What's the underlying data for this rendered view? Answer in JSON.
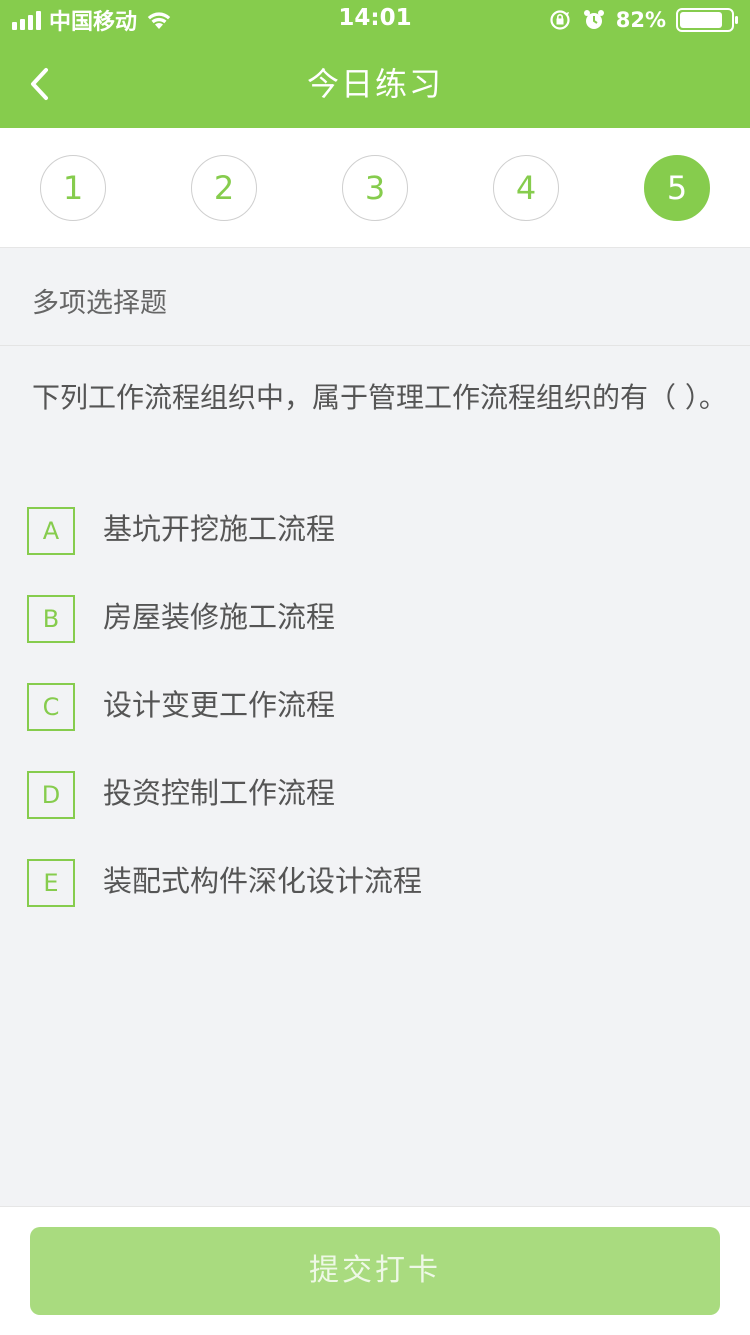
{
  "status_bar": {
    "carrier": "中国移动",
    "time": "14:01",
    "battery": "82%"
  },
  "nav": {
    "title": "今日练习"
  },
  "question_numbers": [
    "1",
    "2",
    "3",
    "4",
    "5"
  ],
  "active_question": "5",
  "question_type": "多项选择题",
  "question_stem": "下列工作流程组织中，属于管理工作流程组织的有（ ）。",
  "options": [
    {
      "letter": "A",
      "text": "基坑开挖施工流程"
    },
    {
      "letter": "B",
      "text": "房屋装修施工流程"
    },
    {
      "letter": "C",
      "text": "设计变更工作流程"
    },
    {
      "letter": "D",
      "text": "投资控制工作流程"
    },
    {
      "letter": "E",
      "text": "装配式构件深化设计流程"
    }
  ],
  "submit_label": "提交打卡",
  "colors": {
    "brand_green": "#86cc4d",
    "button_disabled": "#a9db7f",
    "page_background": "#f2f3f5"
  },
  "icons": [
    "back-arrow-icon",
    "wifi-icon",
    "signal-icon",
    "lock-rotation-icon",
    "alarm-icon",
    "battery-icon"
  ]
}
